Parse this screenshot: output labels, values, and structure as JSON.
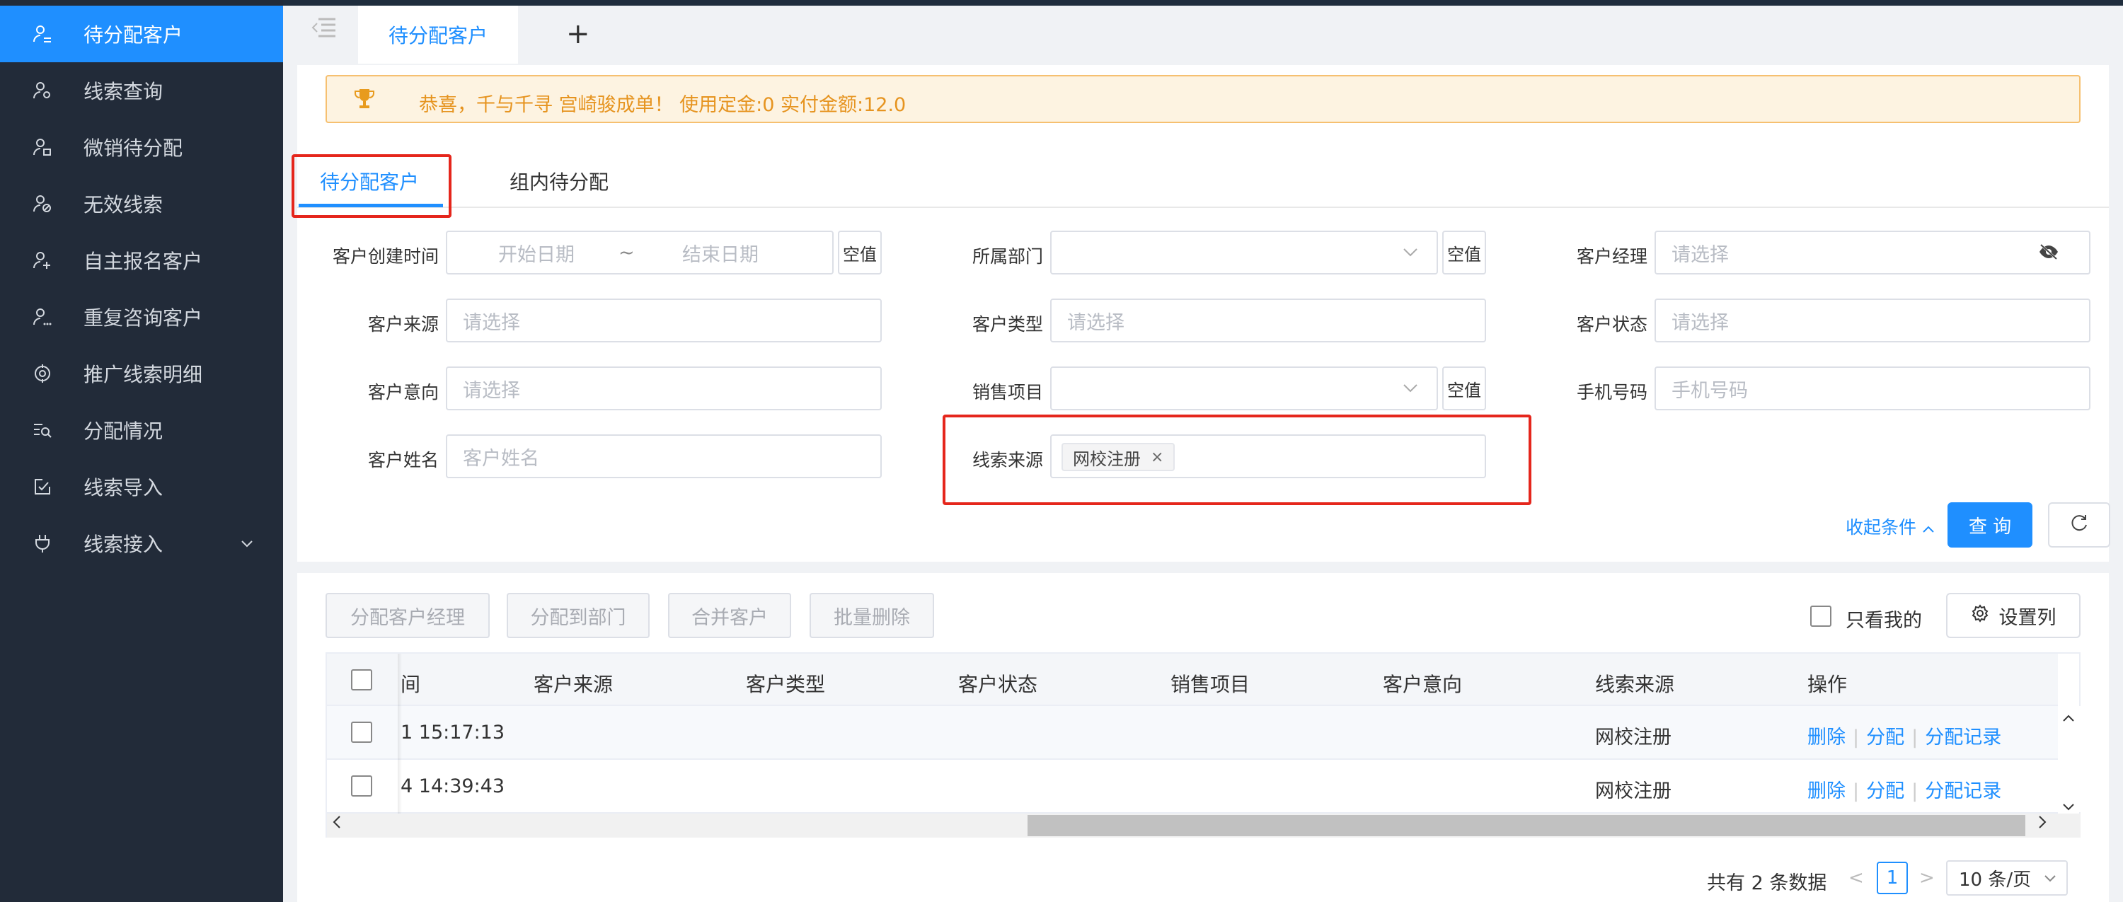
{
  "sidebar": {
    "items": [
      {
        "label": "待分配客户",
        "icon": "user-list-icon",
        "active": true
      },
      {
        "label": "线索查询",
        "icon": "user-search-icon"
      },
      {
        "label": "微销待分配",
        "icon": "user-assign-icon"
      },
      {
        "label": "无效线索",
        "icon": "user-invalid-icon"
      },
      {
        "label": "自主报名客户",
        "icon": "user-signup-icon"
      },
      {
        "label": "重复咨询客户",
        "icon": "user-repeat-icon"
      },
      {
        "label": "推广线索明细",
        "icon": "target-icon"
      },
      {
        "label": "分配情况",
        "icon": "list-search-icon"
      },
      {
        "label": "线索导入",
        "icon": "import-icon"
      },
      {
        "label": "线索接入",
        "icon": "plug-icon",
        "has_submenu": true
      }
    ],
    "active_color": "#1f8fff",
    "bg_color": "#222b39"
  },
  "tabs": {
    "open_tab": "待分配客户",
    "add_symbol": "+"
  },
  "notice": {
    "text": "恭喜，千与千寻  宫崎骏成单！   使用定金:0 实付金额:12.0"
  },
  "inner_tabs": [
    {
      "label": "待分配客户",
      "active": true
    },
    {
      "label": "组内待分配",
      "active": false
    }
  ],
  "filters": {
    "create_time": {
      "label": "客户创建时间",
      "start_placeholder": "开始日期",
      "separator": "~",
      "end_placeholder": "结束日期",
      "null_btn": "空值"
    },
    "department": {
      "label": "所属部门",
      "value": "",
      "null_btn": "空值"
    },
    "manager": {
      "label": "客户经理",
      "placeholder": "请选择"
    },
    "source": {
      "label": "客户来源",
      "placeholder": "请选择"
    },
    "type": {
      "label": "客户类型",
      "placeholder": "请选择"
    },
    "status": {
      "label": "客户状态",
      "placeholder": "请选择"
    },
    "intent": {
      "label": "客户意向",
      "placeholder": "请选择"
    },
    "sales_project": {
      "label": "销售项目",
      "value": "",
      "null_btn": "空值"
    },
    "phone": {
      "label": "手机号码",
      "placeholder": "手机号码"
    },
    "name": {
      "label": "客户姓名",
      "placeholder": "客户姓名"
    },
    "lead_source": {
      "label": "线索来源",
      "tag": "网校注册",
      "tag_close": "×"
    }
  },
  "search_actions": {
    "collapse": "收起条件",
    "query": "查 询",
    "refresh_symbol": "C"
  },
  "toolbar": {
    "assign_manager": "分配客户经理",
    "assign_dept": "分配到部门",
    "merge": "合并客户",
    "batch_delete": "批量删除",
    "only_mine": "只看我的",
    "set_columns": "设置列"
  },
  "table": {
    "columns": [
      "间",
      "客户来源",
      "客户类型",
      "客户状态",
      "销售项目",
      "客户意向",
      "线索来源",
      "操作"
    ],
    "rows": [
      {
        "time": "1 15:17:13",
        "source": "",
        "type": "",
        "status": "",
        "project": "",
        "intent": "",
        "lead_source": "网校注册"
      },
      {
        "time": "4 14:39:43",
        "source": "",
        "type": "",
        "status": "",
        "project": "",
        "intent": "",
        "lead_source": "网校注册"
      }
    ],
    "actions": {
      "delete": "删除",
      "assign": "分配",
      "assign_log": "分配记录"
    }
  },
  "pagination": {
    "total": "共有 2 条数据",
    "prev": "<",
    "next": ">",
    "current": "1",
    "page_size": "10 条/页"
  }
}
